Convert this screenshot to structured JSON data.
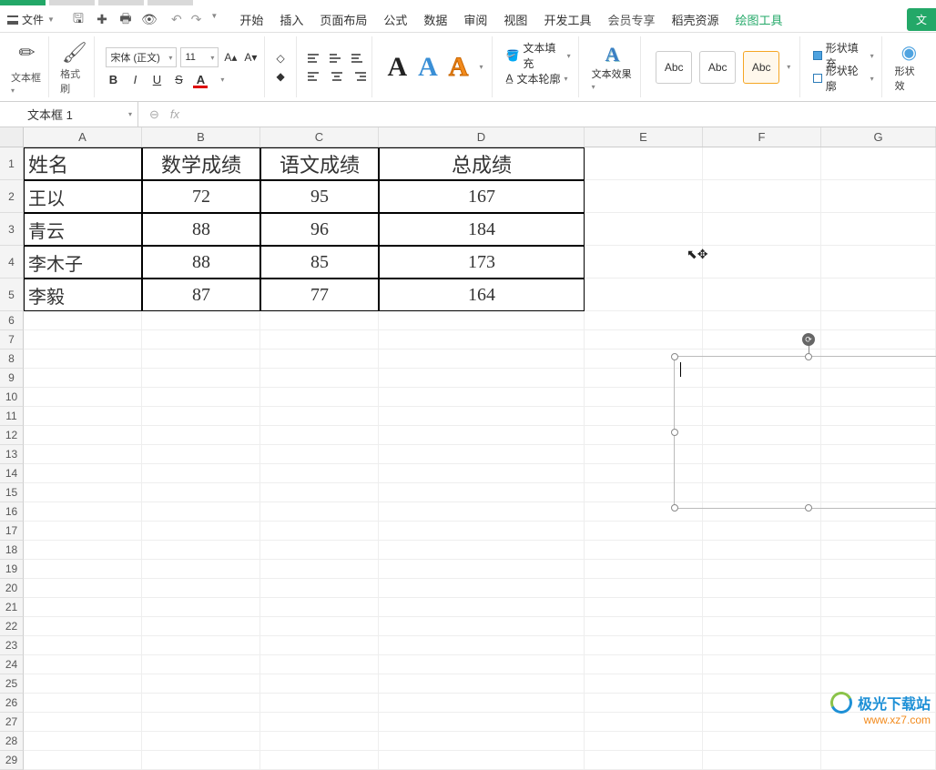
{
  "file_menu": "文件",
  "menus": {
    "start": "开始",
    "insert": "插入",
    "layout": "页面布局",
    "formula": "公式",
    "data": "数据",
    "review": "审阅",
    "view": "视图",
    "dev": "开发工具",
    "vip": "会员专享",
    "daoke": "稻壳资源",
    "draw": "绘图工具",
    "right": "文"
  },
  "ribbon": {
    "textbox": "文本框",
    "formatpaint": "格式刷",
    "font_name": "宋体 (正文)",
    "font_size": "11",
    "text_fill": "文本填充",
    "text_outline": "文本轮廓",
    "text_effect": "文本效果",
    "abc": "Abc",
    "shape_fill": "形状填充",
    "shape_outline": "形状轮廓",
    "shape_effect": "形状效"
  },
  "wordart_letter": "A",
  "namebox": "文本框 1",
  "columns": [
    "A",
    "B",
    "C",
    "D",
    "E",
    "F",
    "G"
  ],
  "row_numbers": [
    1,
    2,
    3,
    4,
    5,
    6,
    7,
    8,
    9,
    10,
    11,
    12,
    13,
    14,
    15,
    16,
    17,
    18,
    19,
    20,
    21,
    22,
    23,
    24,
    25,
    26,
    27,
    28,
    29
  ],
  "table": {
    "headers": [
      "姓名",
      "数学成绩",
      "语文成绩",
      "总成绩"
    ],
    "rows": [
      {
        "name": "王以",
        "math": "72",
        "chinese": "95",
        "total": "167"
      },
      {
        "name": "青云",
        "math": "88",
        "chinese": "96",
        "total": "184"
      },
      {
        "name": "李木子",
        "math": "88",
        "chinese": "85",
        "total": "173"
      },
      {
        "name": "李毅",
        "math": "87",
        "chinese": "77",
        "total": "164"
      }
    ]
  },
  "watermark": {
    "name": "极光下载站",
    "url": "www.xz7.com"
  }
}
